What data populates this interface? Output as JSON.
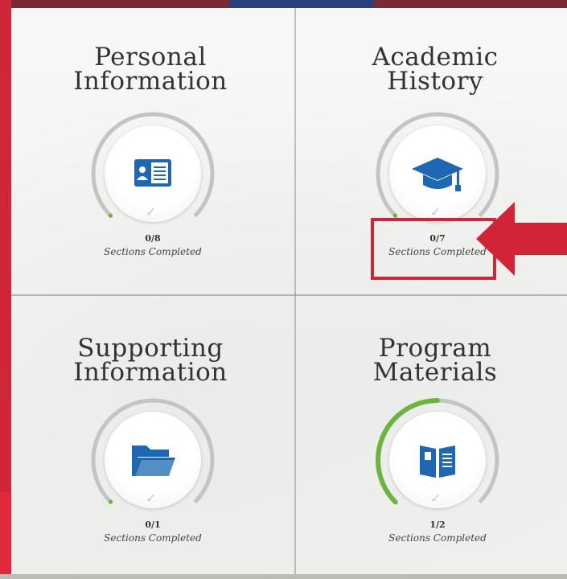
{
  "cards": [
    {
      "title_line1": "Personal",
      "title_line2": "Information",
      "completed": 0,
      "total": 8,
      "count": "0/8",
      "label": "Sections Completed",
      "icon": "id-card-icon"
    },
    {
      "title_line1": "Academic",
      "title_line2": "History",
      "completed": 0,
      "total": 7,
      "count": "0/7",
      "label": "Sections Completed",
      "icon": "graduation-cap-icon"
    },
    {
      "title_line1": "Supporting",
      "title_line2": "Information",
      "completed": 0,
      "total": 1,
      "count": "0/1",
      "label": "Sections Completed",
      "icon": "folder-icon"
    },
    {
      "title_line1": "Program",
      "title_line2": "Materials",
      "completed": 1,
      "total": 2,
      "count": "1/2",
      "label": "Sections Completed",
      "icon": "book-icon"
    }
  ],
  "colors": {
    "accent_blue": "#1d67b3",
    "progress_green": "#6db33f",
    "ring_gray": "#c4c4c4",
    "highlight_red": "#d12537"
  }
}
